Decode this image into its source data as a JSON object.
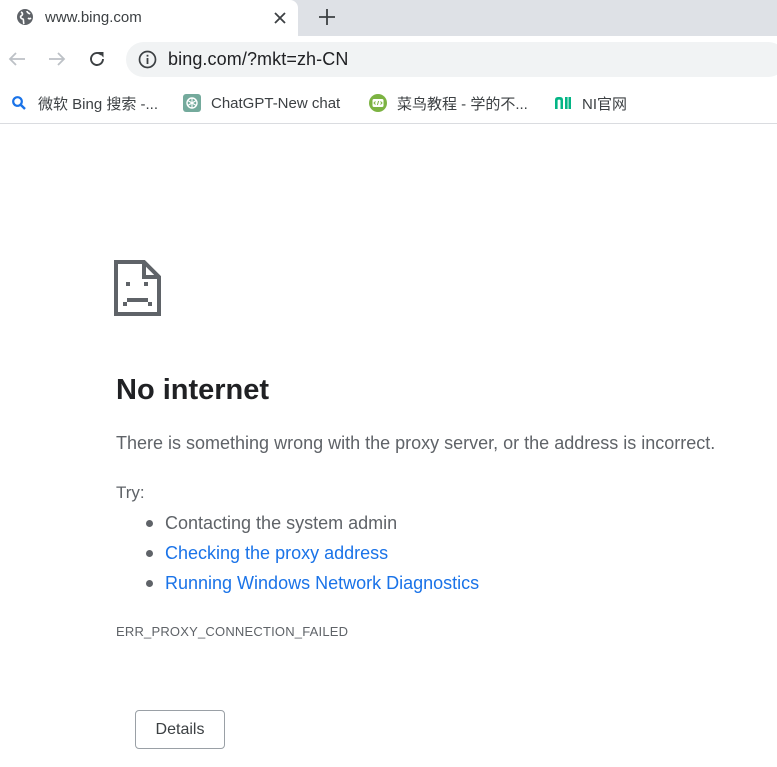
{
  "tab": {
    "title": "www.bing.com",
    "favicon": "globe-icon",
    "close_icon": "close-icon",
    "new_tab_icon": "plus-icon"
  },
  "toolbar": {
    "back_icon": "arrow-left-icon",
    "forward_icon": "arrow-right-icon",
    "reload_icon": "reload-icon",
    "info_icon": "info-icon",
    "url": "bing.com/?mkt=zh-CN"
  },
  "bookmarks": [
    {
      "label": "微软 Bing 搜索 -...",
      "icon": "bing-search-icon"
    },
    {
      "label": "ChatGPT-New chat",
      "icon": "chatgpt-icon"
    },
    {
      "label": "菜鸟教程 - 学的不...",
      "icon": "runoob-icon"
    },
    {
      "label": "NI官网",
      "icon": "ni-logo-icon"
    }
  ],
  "error": {
    "icon": "sad-page-icon",
    "title": "No internet",
    "description": "There is something wrong with the proxy server, or the address is incorrect.",
    "try_label": "Try:",
    "suggestions": [
      {
        "text": "Contacting the system admin",
        "link": false
      },
      {
        "text": "Checking the proxy address",
        "link": true
      },
      {
        "text": "Running Windows Network Diagnostics",
        "link": true
      }
    ],
    "code": "ERR_PROXY_CONNECTION_FAILED",
    "details_label": "Details"
  },
  "colors": {
    "tab_strip_bg": "#dee1e6",
    "omnibox_bg": "#f1f3f4",
    "link": "#1a73e8",
    "secondary_text": "#5f6368"
  }
}
